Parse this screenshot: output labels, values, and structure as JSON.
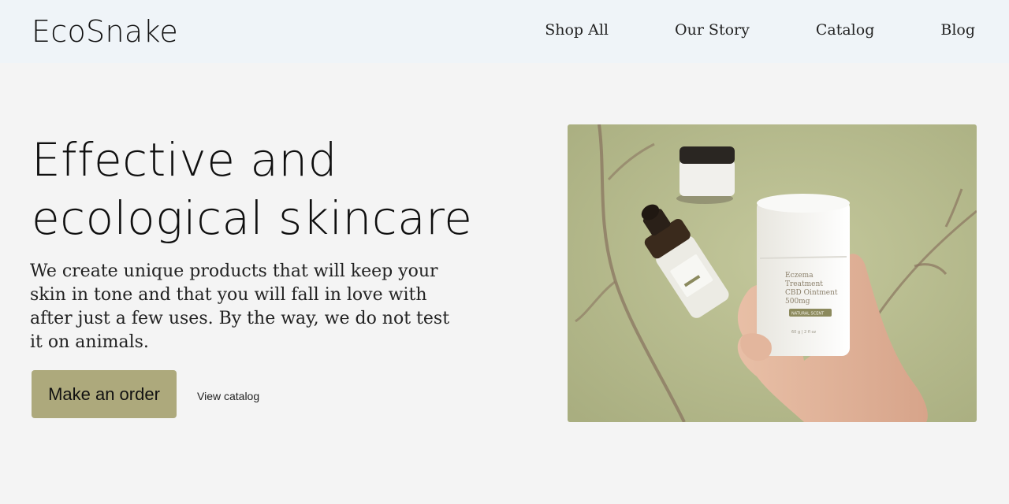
{
  "header": {
    "logo": "EcoSnake",
    "nav": [
      "Shop All",
      "Our Story",
      "Catalog",
      "Blog"
    ]
  },
  "hero": {
    "headline_line1": "Effective and",
    "headline_line2": "ecological skincare",
    "subtitle": "We create unique products that will keep your skin in tone and that you will fall in love with after just a few uses. By the way, we do not test it on animals.",
    "primary_button": "Make an order",
    "secondary_link": "View catalog",
    "image": {
      "label_line1": "Eczema",
      "label_line2": "Treatment",
      "label_line3": "CBD Ointment",
      "label_line4": "500mg",
      "label_badge": "NATURAL SCENT",
      "label_small": "60 g | 2 fl oz"
    }
  },
  "colors": {
    "header_bg": "#eff4f8",
    "page_bg": "#f4f4f4",
    "button_bg": "#ada97c",
    "image_bg": "#b8bd8e"
  }
}
